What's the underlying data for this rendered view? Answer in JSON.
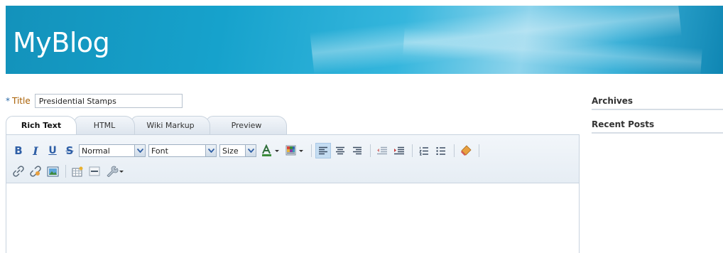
{
  "header": {
    "brand": "MyBlog",
    "colors": {
      "banner": "#16a2cc",
      "text": "#ffffff"
    }
  },
  "form": {
    "title_required_marker": "*",
    "title_label": "Title",
    "title_value": "Presidential Stamps"
  },
  "editor_tabs": [
    {
      "label": "Rich Text",
      "active": true
    },
    {
      "label": "HTML",
      "active": false
    },
    {
      "label": "Wiki Markup",
      "active": false
    },
    {
      "label": "Preview",
      "active": false
    }
  ],
  "toolbar": {
    "bold_label": "B",
    "italic_label": "I",
    "underline_label": "U",
    "strike_label": "S",
    "style_select": "Normal",
    "font_select": "Font",
    "size_select": "Size",
    "icons": [
      "bold-icon",
      "italic-icon",
      "underline-icon",
      "strikethrough-icon",
      "text-color-icon",
      "background-color-icon",
      "align-left-icon",
      "align-center-icon",
      "align-right-icon",
      "outdent-icon",
      "indent-icon",
      "numbered-list-icon",
      "bullet-list-icon",
      "remove-format-icon",
      "link-icon",
      "unlink-icon",
      "image-icon",
      "insert-table-icon",
      "horizontal-rule-icon",
      "tools-icon"
    ],
    "accent": "#2f5fa6",
    "selected_bg": "#c5ddf2"
  },
  "sidebar": {
    "archives_title": "Archives",
    "recent_posts_title": "Recent Posts"
  }
}
